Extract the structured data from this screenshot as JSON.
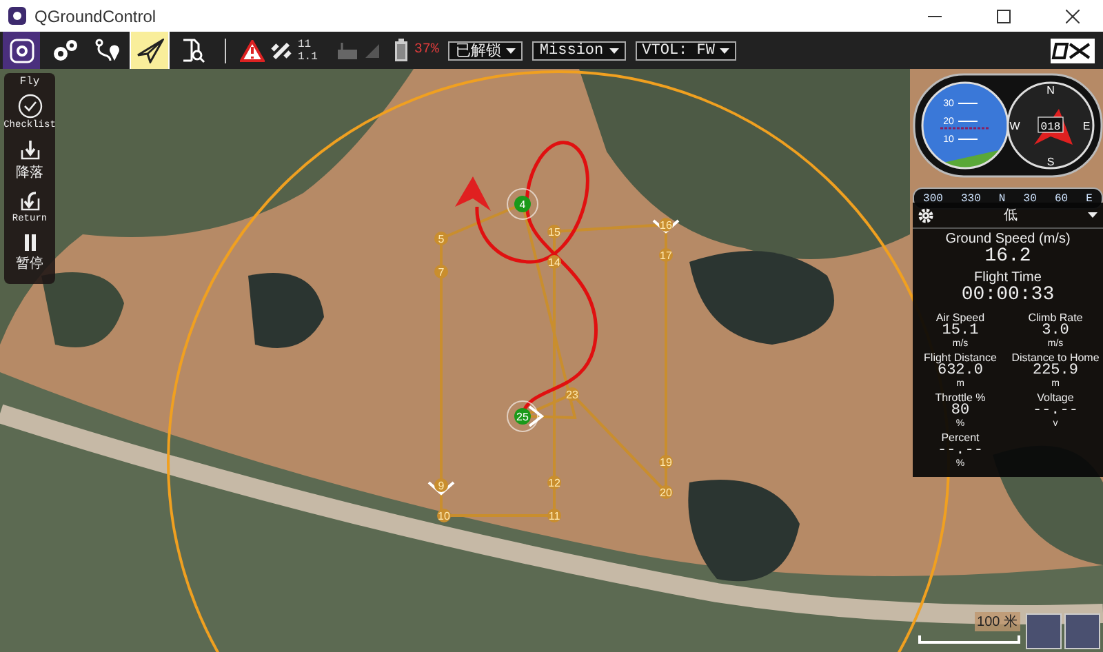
{
  "window": {
    "title": "QGroundControl"
  },
  "toolbar": {
    "tools": [
      {
        "kind": "logo",
        "selected": false
      },
      {
        "kind": "settings",
        "selected": false
      },
      {
        "kind": "plan",
        "selected": false
      },
      {
        "kind": "fly",
        "selected": true
      },
      {
        "kind": "analyze",
        "selected": false
      }
    ],
    "gps": {
      "count": "11",
      "hdop": "1.1"
    },
    "battery": {
      "percent": "37%"
    },
    "menus": [
      {
        "label": "已解锁"
      },
      {
        "label": "Mission"
      },
      {
        "label": "VTOL: FW"
      }
    ]
  },
  "fly_panel": {
    "title": "Fly",
    "actions": [
      {
        "kind": "checklist",
        "label": "Checklist"
      },
      {
        "kind": "land",
        "label": "降落"
      },
      {
        "kind": "return",
        "label": "Return"
      },
      {
        "kind": "pause",
        "label": "暂停"
      }
    ]
  },
  "instruments": {
    "pitch_labels": [
      "30",
      "20",
      "10"
    ],
    "compass": [
      "N",
      "E",
      "S",
      "W"
    ],
    "heading": "018",
    "tape": [
      "300",
      "330",
      "N",
      "30",
      "60",
      "E"
    ]
  },
  "telemetry": {
    "header": "低",
    "primary": [
      {
        "label": "Ground Speed (m/s)",
        "value": "16.2"
      },
      {
        "label": "Flight Time",
        "value": "00:00:33"
      }
    ],
    "grid": [
      {
        "label": "Air Speed",
        "value": "15.1",
        "unit": "m/s"
      },
      {
        "label": "Climb Rate",
        "value": "3.0",
        "unit": "m/s"
      },
      {
        "label": "Flight Distance",
        "value": "632.0",
        "unit": "m"
      },
      {
        "label": "Distance to Home",
        "value": "225.9",
        "unit": "m"
      },
      {
        "label": "Throttle %",
        "value": "80",
        "unit": "%"
      },
      {
        "label": "Voltage",
        "value": "--.--",
        "unit": "v"
      },
      {
        "label": "Percent",
        "value": "--.--",
        "unit": "%"
      }
    ]
  },
  "map": {
    "waypoints": [
      {
        "label": "4",
        "kind": "vehicle"
      },
      {
        "label": "16",
        "kind": "plain"
      },
      {
        "label": "15",
        "kind": "plain"
      },
      {
        "label": "5",
        "kind": "plain"
      },
      {
        "label": "17",
        "kind": "plain"
      },
      {
        "label": "14",
        "kind": "plain"
      },
      {
        "label": "7",
        "kind": "plain"
      },
      {
        "label": "23",
        "kind": "plain"
      },
      {
        "label": "25",
        "kind": "vehicle"
      },
      {
        "label": "19",
        "kind": "plain"
      },
      {
        "label": "12",
        "kind": "plain"
      },
      {
        "label": "9",
        "kind": "plain"
      },
      {
        "label": "20",
        "kind": "plain"
      },
      {
        "label": "10",
        "kind": "plain"
      },
      {
        "label": "11",
        "kind": "plain"
      }
    ],
    "scale": "100 米"
  }
}
